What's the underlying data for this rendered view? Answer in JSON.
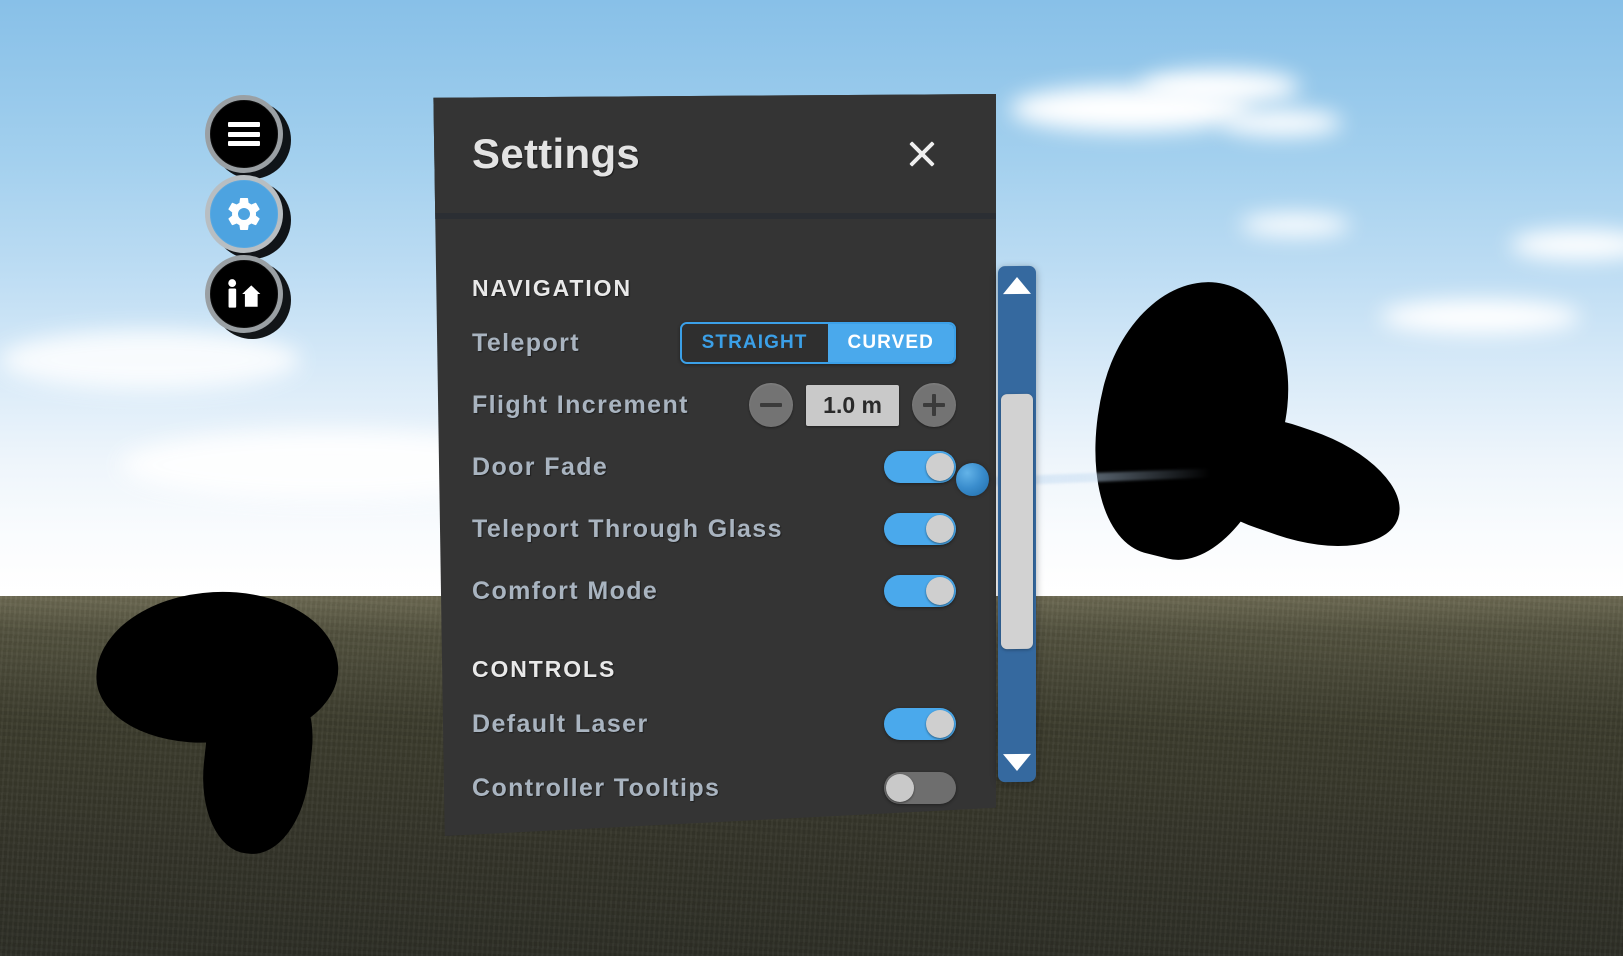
{
  "scene": {
    "environment": "outdoor-sky-ground",
    "sky_color": "#8cc2e9",
    "ground_color": "#3d3d2e",
    "controller_color": "#000000",
    "laser_color": "#d2e4f5",
    "cursor_color": "#3a8dcd"
  },
  "toolbar": {
    "items": [
      {
        "name": "menu-button",
        "icon": "hamburger-menu-icon",
        "active": false
      },
      {
        "name": "settings-button",
        "icon": "gear-icon",
        "active": true
      },
      {
        "name": "avatar-home-button",
        "icon": "person-house-icon",
        "active": false
      }
    ],
    "active_color": "#4da3e0",
    "ring_color": "#9aa0a4"
  },
  "panel": {
    "title": "Settings",
    "close_icon": "close-icon",
    "accent_color": "#4aa9ec",
    "background_color": "#343434",
    "label_color": "#a9b4c0",
    "sections": [
      {
        "title": "NAVIGATION",
        "rows": [
          {
            "label": "Teleport",
            "control": "segmented",
            "options": [
              "STRAIGHT",
              "CURVED"
            ],
            "selected": "CURVED"
          },
          {
            "label": "Flight Increment",
            "control": "stepper",
            "value": "1.0 m",
            "decrement_icon": "minus-icon",
            "increment_icon": "plus-icon"
          },
          {
            "label": "Door Fade",
            "control": "toggle",
            "value": true
          },
          {
            "label": "Teleport Through Glass",
            "control": "toggle",
            "value": true
          },
          {
            "label": "Comfort Mode",
            "control": "toggle",
            "value": true
          }
        ]
      },
      {
        "title": "CONTROLS",
        "rows": [
          {
            "label": "Default Laser",
            "control": "toggle",
            "value": true
          },
          {
            "label": "Controller Tooltips",
            "control": "toggle",
            "value": false
          }
        ]
      }
    ]
  },
  "scrollbar": {
    "up_arrow_icon": "chevron-up-icon",
    "down_arrow_icon": "chevron-down-icon",
    "track_color": "#35699f",
    "thumb_color": "#d2d2d2",
    "thumb_position_percent": 25
  }
}
